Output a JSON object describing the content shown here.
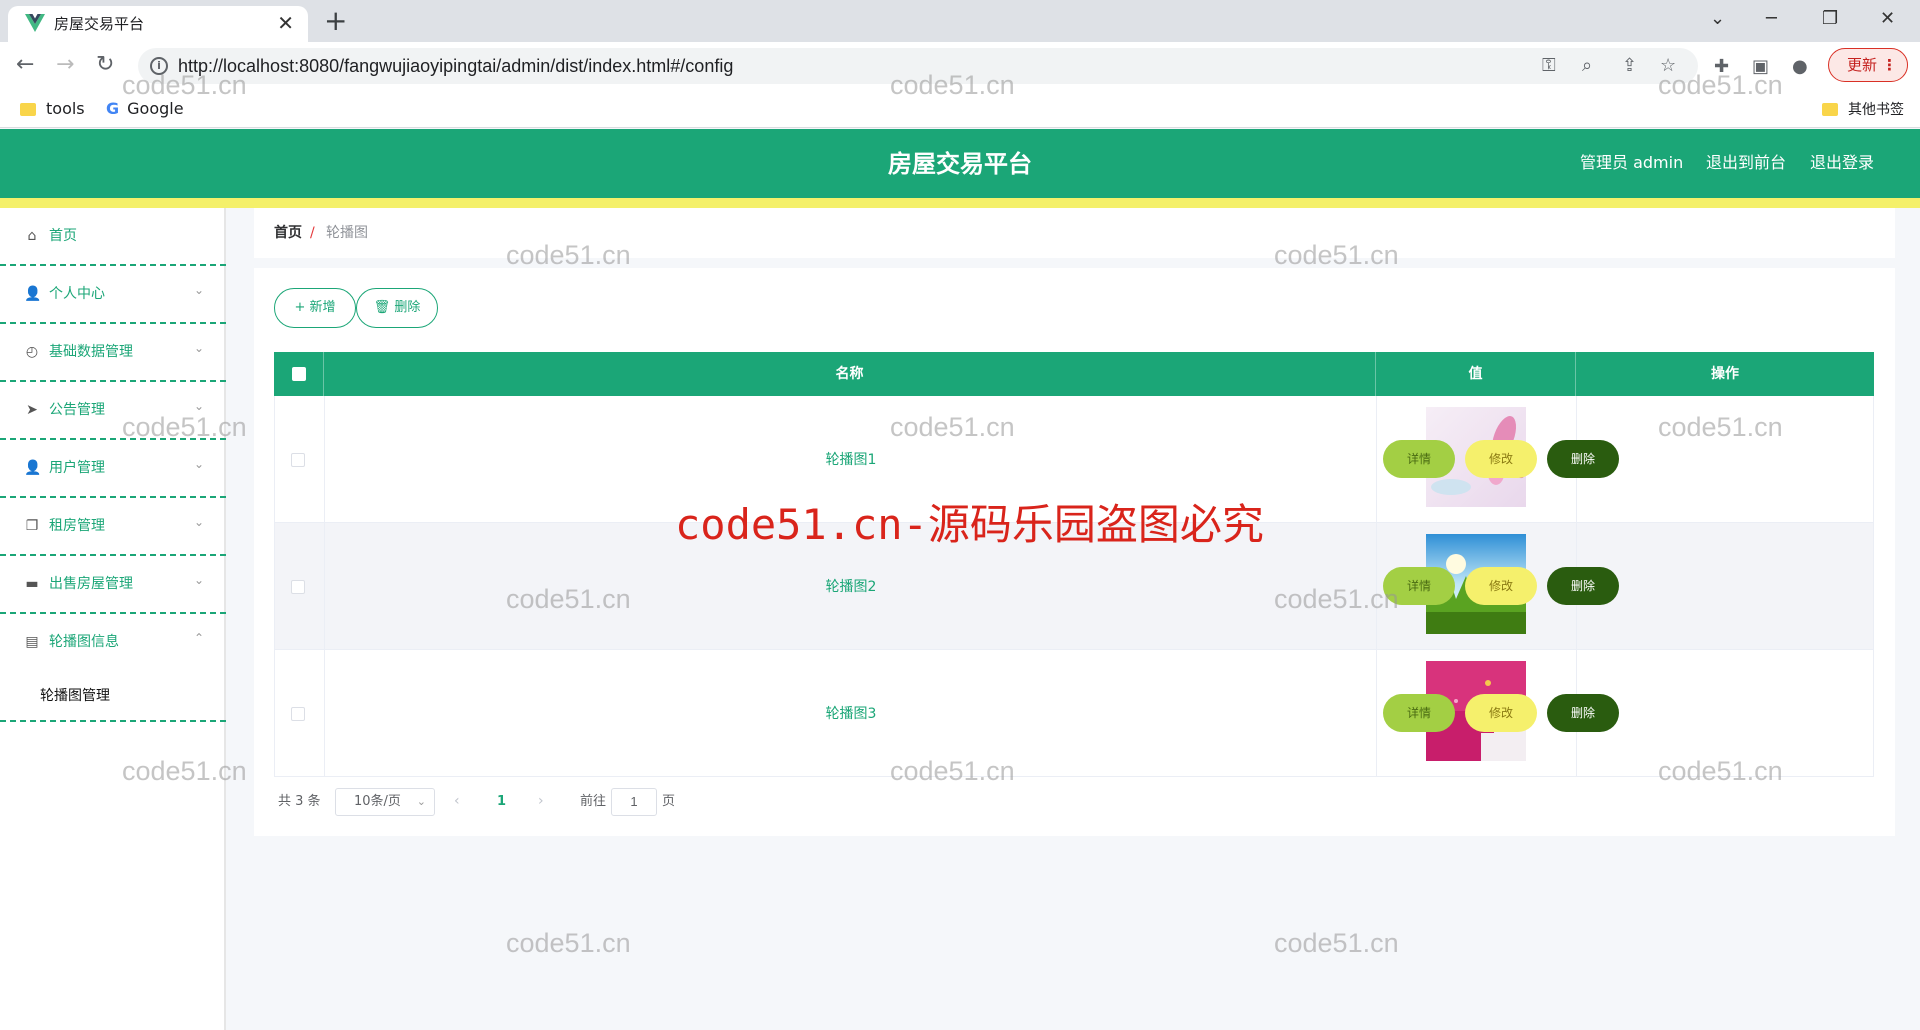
{
  "browser": {
    "tab_title": "房屋交易平台",
    "url": "http://localhost:8080/fangwujiaoyipingtai/admin/dist/index.html#/config",
    "update_label": "更新",
    "bookmarks": [
      "tools",
      "Google"
    ],
    "other_bookmarks": "其他书签"
  },
  "header": {
    "title": "房屋交易平台",
    "user": "管理员 admin",
    "to_front": "退出到前台",
    "logout": "退出登录"
  },
  "sidebar": {
    "items": [
      {
        "label": "首页",
        "icon": "home-icon"
      },
      {
        "label": "个人中心",
        "icon": "user-icon"
      },
      {
        "label": "基础数据管理",
        "icon": "compass-icon"
      },
      {
        "label": "公告管理",
        "icon": "send-icon"
      },
      {
        "label": "用户管理",
        "icon": "user-icon"
      },
      {
        "label": "租房管理",
        "icon": "copy-icon"
      },
      {
        "label": "出售房屋管理",
        "icon": "monitor-icon"
      },
      {
        "label": "轮播图信息",
        "icon": "document-icon"
      }
    ],
    "sub_item": "轮播图管理"
  },
  "breadcrumb": {
    "home": "首页",
    "separator": "/",
    "current": "轮播图"
  },
  "toolbar": {
    "add": "+ 新增",
    "delete": "删除"
  },
  "table": {
    "columns": [
      "名称",
      "值",
      "操作"
    ],
    "rows": [
      {
        "name": "轮播图1",
        "image": "pink-flower-image"
      },
      {
        "name": "轮播图2",
        "image": "green-grass-sky-image"
      },
      {
        "name": "轮播图3",
        "image": "magenta-abstract-image"
      }
    ],
    "actions": {
      "detail": "详情",
      "edit": "修改",
      "delete": "删除"
    }
  },
  "pagination": {
    "total": "共 3 条",
    "page_size": "10条/页",
    "current_page": "1",
    "goto_label": "前往",
    "goto_value": "1",
    "page_unit": "页"
  },
  "watermarks": {
    "small": "code51.cn",
    "big": "code51.cn-源码乐园盗图必究"
  },
  "colors": {
    "primary": "#1ba677",
    "accent_yellow": "#f4f06a",
    "detail": "#a3cf44",
    "edit": "#f5f06c",
    "delete": "#2a5c0f"
  }
}
